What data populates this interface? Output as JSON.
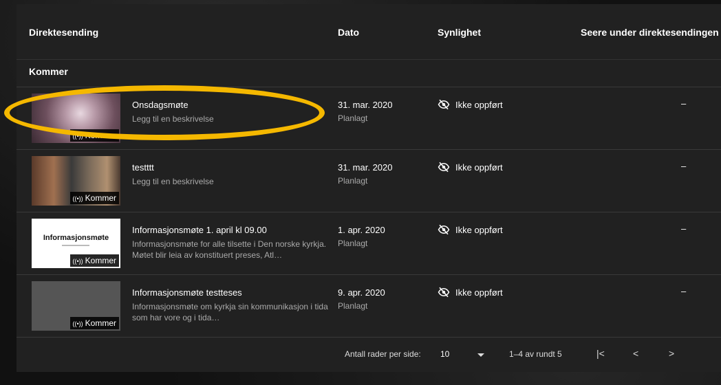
{
  "header": {
    "col_stream": "Direktesending",
    "col_date": "Dato",
    "col_visibility": "Synlighet",
    "col_viewers": "Seere under direktesendingen"
  },
  "section": {
    "label": "Kommer"
  },
  "rows": [
    {
      "title": "Onsdagsmøte",
      "description": "Legg til en beskrivelse",
      "badge": "Kommer",
      "date": "31. mar. 2020",
      "status": "Planlagt",
      "visibility": "Ikke oppført",
      "viewers": "–"
    },
    {
      "title": "testttt",
      "description": "Legg til en beskrivelse",
      "badge": "Kommer",
      "date": "31. mar. 2020",
      "status": "Planlagt",
      "visibility": "Ikke oppført",
      "viewers": "–"
    },
    {
      "title": "Informasjonsmøte 1. april kl 09.00",
      "description": "Informasjonsmøte for alle tilsette i Den norske kyrkja. Møtet blir leia av konstituert preses, Atl…",
      "badge": "Kommer",
      "thumb_text": "Informasjonsmøte",
      "date": "1. apr. 2020",
      "status": "Planlagt",
      "visibility": "Ikke oppført",
      "viewers": "–"
    },
    {
      "title": "Informasjonsmøte testteses",
      "description": "Informasjonsmøte om kyrkja sin kommunikasjon i tida som har vore og i tida…",
      "badge": "Kommer",
      "date": "9. apr. 2020",
      "status": "Planlagt",
      "visibility": "Ikke oppført",
      "viewers": "–"
    }
  ],
  "live_icon": "((•))",
  "footer": {
    "rows_per_page_label": "Antall rader per side:",
    "rows_per_page_value": "10",
    "range": "1–4 av rundt 5",
    "first_page": "|<",
    "prev_page": "<",
    "next_page": ">"
  },
  "icons": {
    "visibility": "eye-off-icon",
    "dropdown": "caret-down-icon"
  },
  "colors": {
    "highlight": "#f5b800",
    "panel": "#212121"
  }
}
